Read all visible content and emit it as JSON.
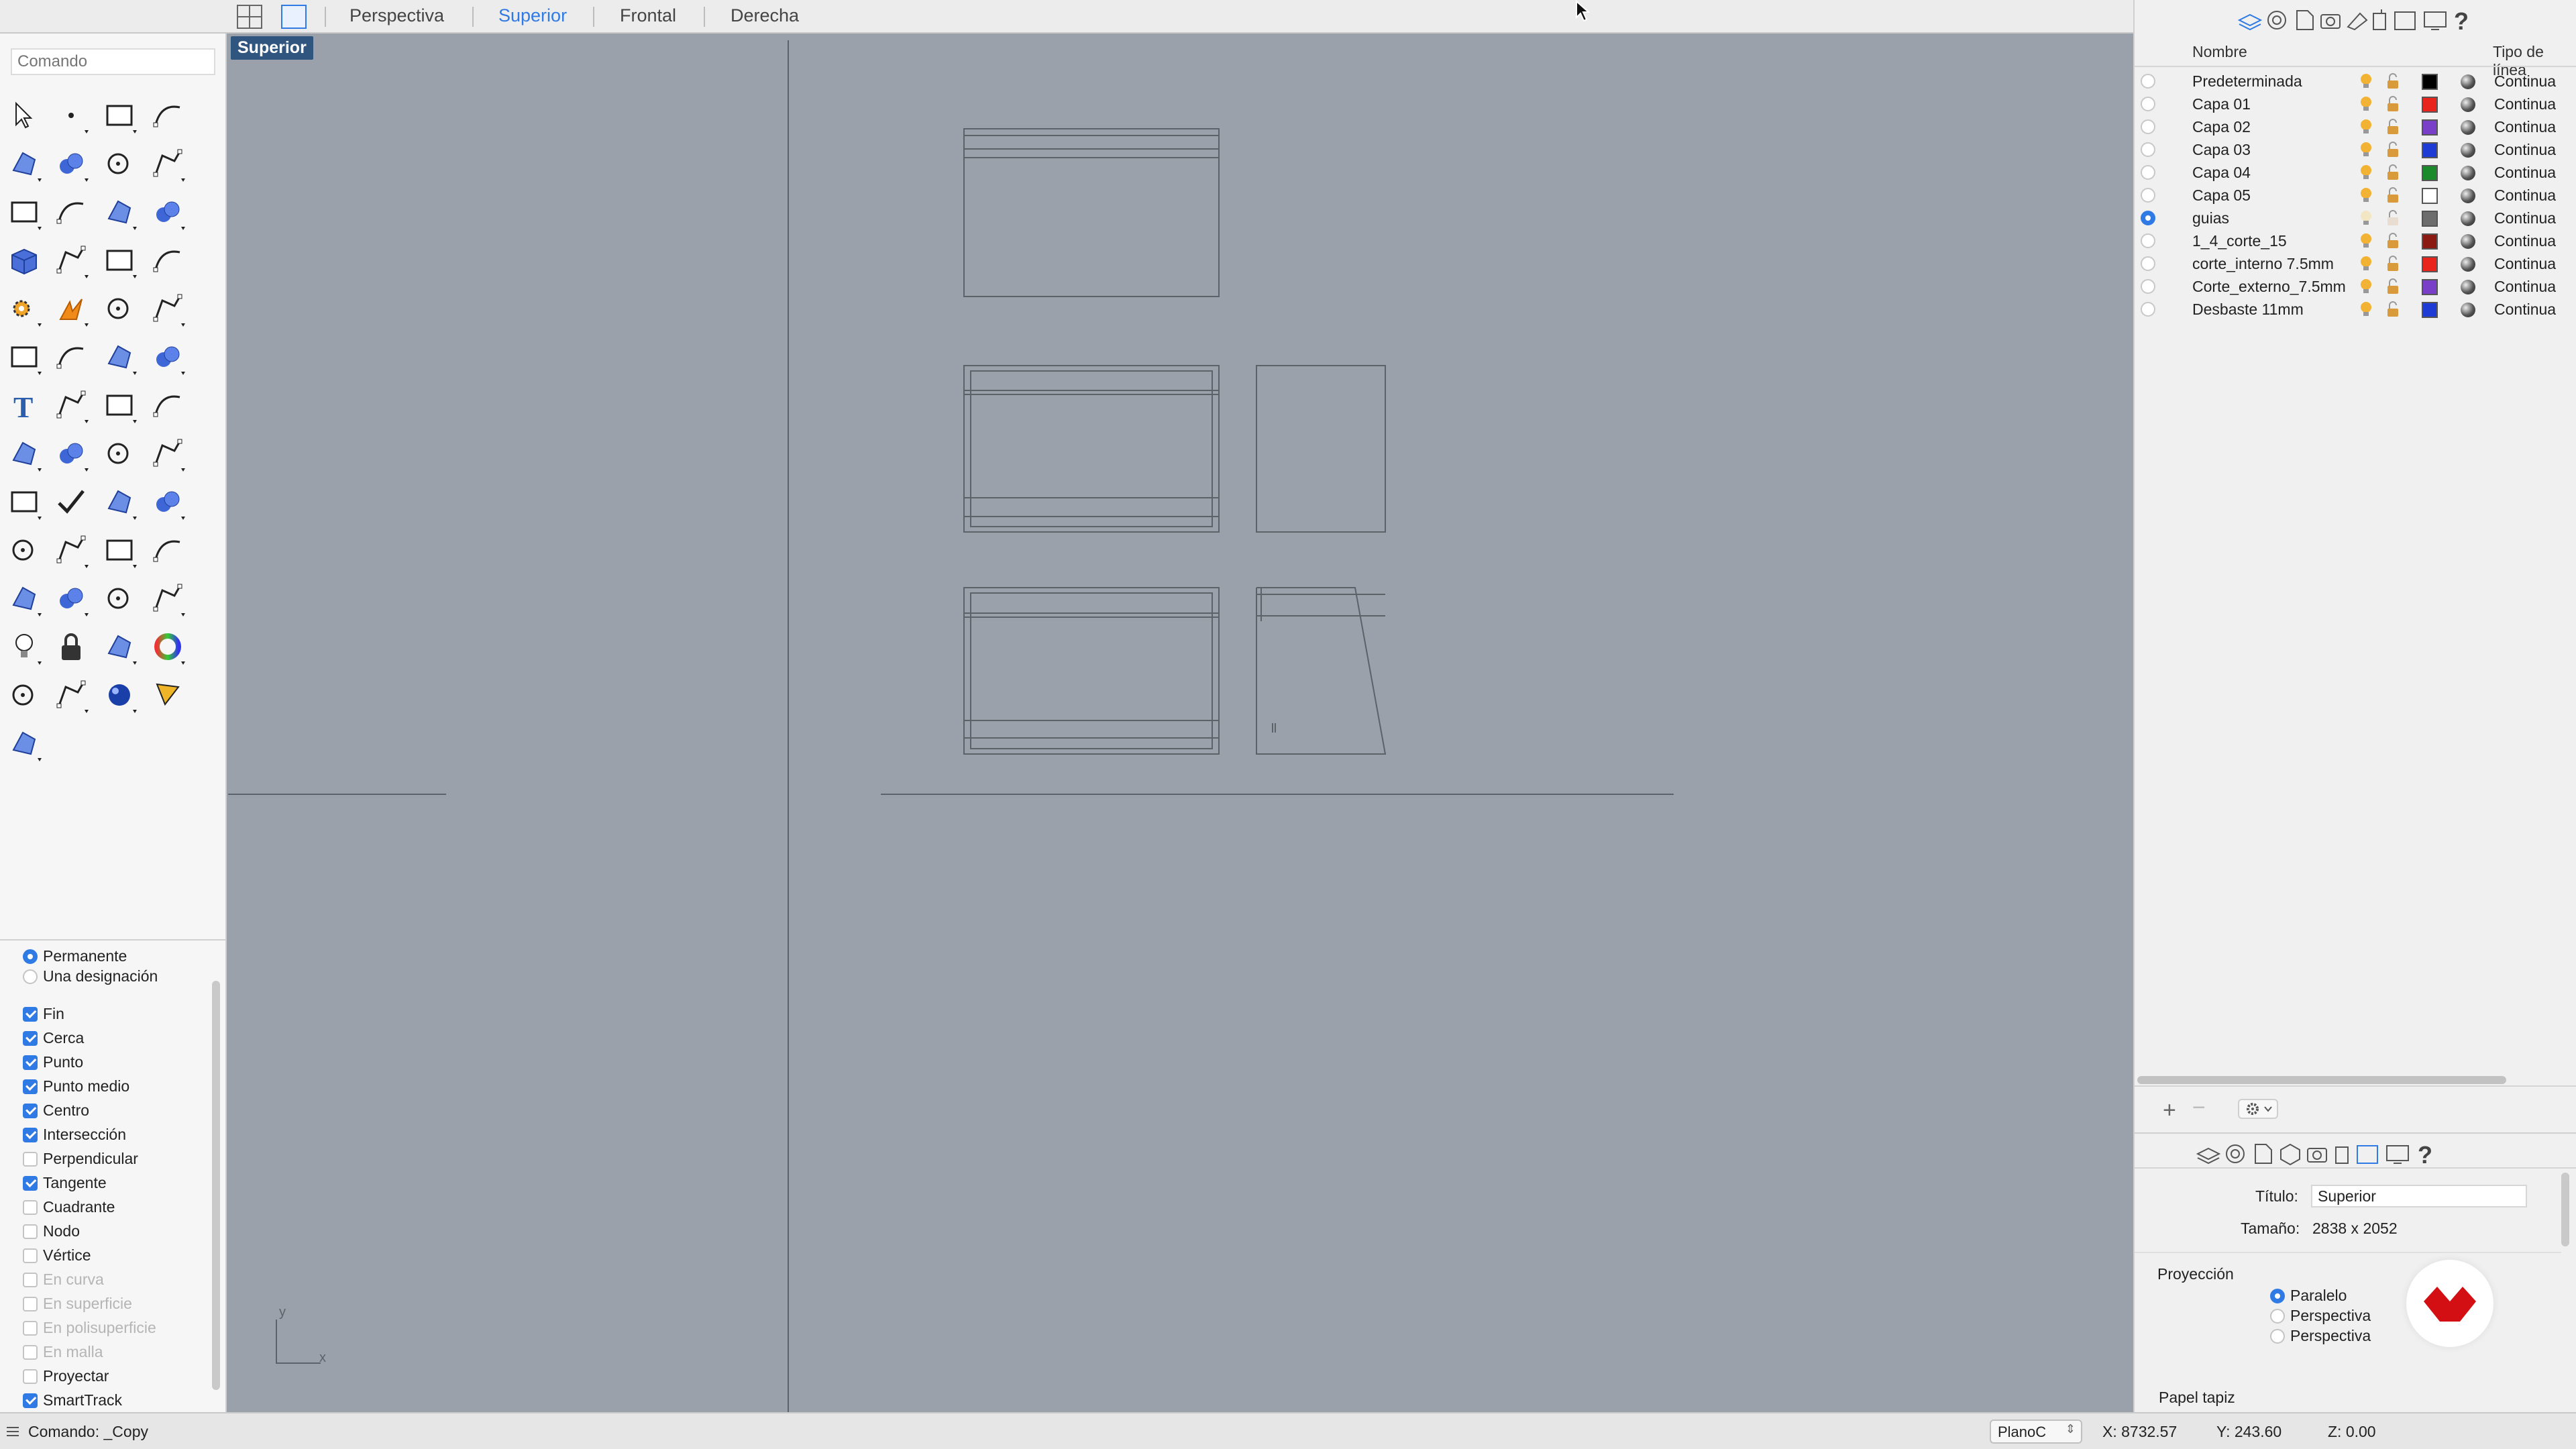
{
  "topbar": {
    "tabs": [
      {
        "label": "Perspectiva",
        "active": false
      },
      {
        "label": "Superior",
        "active": true
      },
      {
        "label": "Frontal",
        "active": false
      },
      {
        "label": "Derecha",
        "active": false
      }
    ]
  },
  "command": {
    "placeholder": "Comando"
  },
  "toolbar": {
    "icons": [
      "select-arrow-icon",
      "point-icon",
      "polyline-icon",
      "curve-icon",
      "circle-icon",
      "ellipse-icon",
      "arc-icon",
      "rectangle-icon",
      "polygon-icon",
      "fillet-icon",
      "surface-from-points-icon",
      "extrude-surface-icon",
      "box-solid-icon",
      "boolean-union-icon",
      "cylinder-icon",
      "mesh-icon",
      "gear-icon",
      "explode-icon",
      "trim-icon",
      "split-icon",
      "spheres-icon",
      "join-icon",
      "offset-curve-icon",
      "rebuild-curve-icon",
      "text-icon",
      "scale-icon",
      "move-icon",
      "edit-icon",
      "group-icon",
      "dimension-icon",
      "array-icon",
      "align-icon",
      "layer-sheet-icon",
      "check-icon",
      "fillet-edge-icon",
      "project-icon",
      "zoom-extents-icon",
      "zoom-window-icon",
      "zoom-selected-icon",
      "zoom-icon",
      "rotate-view-icon",
      "car-icon",
      "grid-plane-icon",
      "named-views-icon",
      "light-bulb-icon",
      "lock-icon",
      "material-icon",
      "color-wheel-icon",
      "render-sphere-icon",
      "wire-sphere-icon",
      "blue-sphere-icon",
      "cone-icon",
      "gumball-icon"
    ]
  },
  "osnap": {
    "mode": [
      {
        "label": "Permanente",
        "checked": true
      },
      {
        "label": "Una designación",
        "checked": false
      }
    ],
    "items": [
      {
        "label": "Fin",
        "checked": true,
        "disabled": false
      },
      {
        "label": "Cerca",
        "checked": true,
        "disabled": false
      },
      {
        "label": "Punto",
        "checked": true,
        "disabled": false
      },
      {
        "label": "Punto medio",
        "checked": true,
        "disabled": false
      },
      {
        "label": "Centro",
        "checked": true,
        "disabled": false
      },
      {
        "label": "Intersección",
        "checked": true,
        "disabled": false
      },
      {
        "label": "Perpendicular",
        "checked": false,
        "disabled": false
      },
      {
        "label": "Tangente",
        "checked": true,
        "disabled": false
      },
      {
        "label": "Cuadrante",
        "checked": false,
        "disabled": false
      },
      {
        "label": "Nodo",
        "checked": false,
        "disabled": false
      },
      {
        "label": "Vértice",
        "checked": false,
        "disabled": false
      },
      {
        "label": "En curva",
        "checked": false,
        "disabled": true
      },
      {
        "label": "En superficie",
        "checked": false,
        "disabled": true
      },
      {
        "label": "En polisuperficie",
        "checked": false,
        "disabled": true
      },
      {
        "label": "En malla",
        "checked": false,
        "disabled": true
      },
      {
        "label": "Proyectar",
        "checked": false,
        "disabled": false
      },
      {
        "label": "SmartTrack",
        "checked": true,
        "disabled": false
      }
    ]
  },
  "viewport": {
    "title": "Superior",
    "axis_y": "y",
    "axis_x": "x"
  },
  "layers": {
    "header_name": "Nombre",
    "header_linetype": "Tipo de línea",
    "rows": [
      {
        "name": "Predeterminada",
        "color": "#000000",
        "linetype": "Continua",
        "current": false,
        "off": false
      },
      {
        "name": "Capa 01",
        "color": "#e8241c",
        "linetype": "Continua",
        "current": false,
        "off": false
      },
      {
        "name": "Capa 02",
        "color": "#7a3fc9",
        "linetype": "Continua",
        "current": false,
        "off": false
      },
      {
        "name": "Capa 03",
        "color": "#1f3bd6",
        "linetype": "Continua",
        "current": false,
        "off": false
      },
      {
        "name": "Capa 04",
        "color": "#1a8a2a",
        "linetype": "Continua",
        "current": false,
        "off": false
      },
      {
        "name": "Capa 05",
        "color": "#ffffff",
        "linetype": "Continua",
        "current": false,
        "off": false
      },
      {
        "name": "guias",
        "color": "#6d6d6d",
        "linetype": "Continua",
        "current": true,
        "off": true
      },
      {
        "name": "1_4_corte_15",
        "color": "#8a1a12",
        "linetype": "Continua",
        "current": false,
        "off": false
      },
      {
        "name": "corte_interno 7.5mm",
        "color": "#e8241c",
        "linetype": "Continua",
        "current": false,
        "off": false
      },
      {
        "name": "Corte_externo_7.5mm",
        "color": "#7a3fc9",
        "linetype": "Continua",
        "current": false,
        "off": false
      },
      {
        "name": "Desbaste 11mm",
        "color": "#1f3bd6",
        "linetype": "Continua",
        "current": false,
        "off": false
      }
    ]
  },
  "properties": {
    "title_label": "Título:",
    "title_value": "Superior",
    "size_label": "Tamaño:",
    "size_value": "2838 x 2052",
    "projection_label": "Proyección",
    "projection_options": [
      {
        "label": "Paralelo",
        "checked": true
      },
      {
        "label": "Perspectiva",
        "checked": false
      },
      {
        "label": "Perspectiva",
        "checked": false
      }
    ],
    "wallpaper_label": "Papel tapiz"
  },
  "statusbar": {
    "command": "Comando: _Copy",
    "plane": "PlanoC",
    "x": "X: 8732.57",
    "y": "Y: 243.60",
    "z": "Z: 0.00"
  },
  "colors": {
    "accent": "#2f7ae5",
    "viewport_bg": "#9aa1aa",
    "title_tag": "#30557f",
    "logo": "#d40f14"
  }
}
